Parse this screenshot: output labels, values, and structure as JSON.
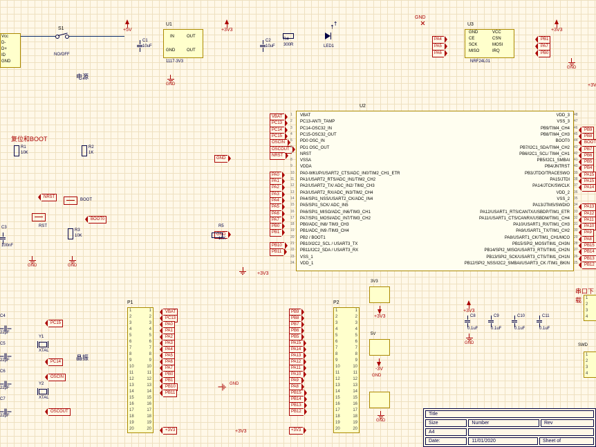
{
  "power_rails": {
    "p5v": "+5V",
    "p3v3": "+3V3",
    "gnd": "GND",
    "n3v": "-3V",
    "p5vlbl": "5V",
    "p3v3lbl": "3V3"
  },
  "sections": {
    "power": "电源",
    "reset_boot": "复位和BOOT",
    "crystal": "晶振",
    "serial": "串口下载"
  },
  "u1": {
    "ref": "U1",
    "value": "1117-3V3",
    "pins": [
      "IN",
      "OUT",
      "GND",
      "OUT"
    ]
  },
  "u2": {
    "ref": "U2",
    "left": [
      {
        "n": "1",
        "t": "VBAT",
        "net": "VBAT"
      },
      {
        "n": "2",
        "t": "PC13-ANTI_TAMP",
        "net": "PC13"
      },
      {
        "n": "3",
        "t": "PC14-OSC32_IN",
        "net": "PC14"
      },
      {
        "n": "4",
        "t": "PC15-OSC32_OUT",
        "net": "PC15"
      },
      {
        "n": "5",
        "t": "PD0 OSC_IN",
        "net": "OSCIN"
      },
      {
        "n": "6",
        "t": "PD1 OSC_OUT",
        "net": "OSCOUT"
      },
      {
        "n": "7",
        "t": "NRST",
        "net": "NRST"
      },
      {
        "n": "8",
        "t": "VSSA",
        "net": ""
      },
      {
        "n": "9",
        "t": "VDDA",
        "net": ""
      },
      {
        "n": "10",
        "t": "PA0-WKUP/USART2_CTS/ADC_IN0/TIM2_CH1_ETR",
        "net": "PA0"
      },
      {
        "n": "11",
        "t": "PA1/USART2_RTS/ADC_IN1/TIM2_CH2",
        "net": "PA1"
      },
      {
        "n": "12",
        "t": "PA2/USART2_TX/ ADC_IN2/ TIM2_CH3",
        "net": "PA2"
      },
      {
        "n": "13",
        "t": "PA3/USART2_RX/ADC_IN3/TIM2_CH4",
        "net": "PA3"
      },
      {
        "n": "14",
        "t": "PA4/SPI1_NSS/USART2_CK/ADC_IN4",
        "net": "PA4"
      },
      {
        "n": "15",
        "t": "PA5/SPI1_SCK/ ADC_IN5",
        "net": "PA5"
      },
      {
        "n": "16",
        "t": "PA6/SPI1_MISO/ADC_IN6/TIM3_CH1",
        "net": "PA6"
      },
      {
        "n": "17",
        "t": "PA7/SPI1_MOSI/ADC_IN7/TIM3_CH2",
        "net": "PA7"
      },
      {
        "n": "18",
        "t": "PB0/ADC_IN8/ TIM3_CH3",
        "net": "PB0"
      },
      {
        "n": "19",
        "t": "PB1/ADC_IN9 /TIM3_CH4",
        "net": "PB1"
      },
      {
        "n": "20",
        "t": "PB2 / BOOT1",
        "net": ""
      },
      {
        "n": "21",
        "t": "PB10/I2C2_SCL / USART3_TX",
        "net": "PB10"
      },
      {
        "n": "22",
        "t": "PB11/I2C2_SDA / USART3_RX",
        "net": "PB11"
      },
      {
        "n": "23",
        "t": "VSS_1",
        "net": ""
      },
      {
        "n": "24",
        "t": "VDD_1",
        "net": ""
      }
    ],
    "right": [
      {
        "n": "48",
        "t": "VDD_3",
        "net": ""
      },
      {
        "n": "47",
        "t": "VSS_3",
        "net": ""
      },
      {
        "n": "46",
        "t": "PB9/TIM4_CH4",
        "net": "PB9"
      },
      {
        "n": "45",
        "t": "PB8/TIM4_CH3",
        "net": "PB8"
      },
      {
        "n": "44",
        "t": "BOOT0",
        "net": "BOOT0"
      },
      {
        "n": "43",
        "t": "PB7/I2C1_SDA/TIM4_CH2",
        "net": "PB7"
      },
      {
        "n": "42",
        "t": "PB6/I2C1_SCL/ TIM4_CH1",
        "net": "PB6"
      },
      {
        "n": "41",
        "t": "PB5/I2C1_SMBAl",
        "net": "PB5"
      },
      {
        "n": "40",
        "t": "PB4/JNTRST",
        "net": "PB4"
      },
      {
        "n": "39",
        "t": "PB3/JTDO/TRACESWO",
        "net": "PA15"
      },
      {
        "n": "38",
        "t": "PA15/JTDI",
        "net": "PA15"
      },
      {
        "n": "37",
        "t": "PA14/JTCK/SWCLK",
        "net": "PA14"
      },
      {
        "n": "36",
        "t": "VDD_2",
        "net": ""
      },
      {
        "n": "35",
        "t": "VSS_2",
        "net": ""
      },
      {
        "n": "34",
        "t": "PA13/JTMS/SWDIO",
        "net": "PA13"
      },
      {
        "n": "33",
        "t": "PA12/USART1_RTS/CANTX/USBDP/TIM1_ETR",
        "net": "PA12"
      },
      {
        "n": "32",
        "t": "PA11/USART1_CTS/CANRX/USBDM/TIM1_CH4",
        "net": "PA11"
      },
      {
        "n": "31",
        "t": "PA10/USART1_RX/TIM1_CH3",
        "net": "PA10"
      },
      {
        "n": "30",
        "t": "PA9/USART1_TX/TIM1_CH2",
        "net": "PA9"
      },
      {
        "n": "29",
        "t": "PA8/USART1_CK/TIM1_CH1/MCO",
        "net": "PA8"
      },
      {
        "n": "28",
        "t": "PB15/SPI2_MOSI/TIM1_CH3N",
        "net": "PB15"
      },
      {
        "n": "27",
        "t": "PB14/SPI2_MISO/USART3_RTS/TIM1_CH2N",
        "net": "PB14"
      },
      {
        "n": "26",
        "t": "PB13/SPI2_SCK/USART3_CTS/TIM1_CH1N",
        "net": "PB13"
      },
      {
        "n": "25",
        "t": "PB12/SPI2_NSS/I2C2_SMBAl/USART3_CK /TIM1_BKIN",
        "net": "PB12"
      }
    ]
  },
  "nrf": {
    "ref": "U3",
    "value": "NRF24L01",
    "left": [
      "GND",
      "CE",
      "SCK",
      "MISO"
    ],
    "right": [
      "VCC",
      "CSN",
      "MOSI",
      "IRQ"
    ],
    "nets_left": [
      "",
      "PA4",
      "PA5",
      "PA6"
    ],
    "nets_right": [
      "PB1",
      "PA7",
      "PB0",
      ""
    ]
  },
  "usb": {
    "ref": "",
    "pins": [
      "Vcc",
      "D-",
      "D+",
      "ID",
      "GND"
    ]
  },
  "switch": {
    "ref": "S1",
    "value": "NO/OFF"
  },
  "parts": {
    "c1": {
      "ref": "C1",
      "val": "10uF"
    },
    "c2": {
      "ref": "C2",
      "val": "10uF"
    },
    "c3": {
      "ref": "C3",
      "val": "100nF"
    },
    "c4": {
      "ref": "C4",
      "val": "22pF"
    },
    "c5": {
      "ref": "C5",
      "val": "22pF"
    },
    "c6": {
      "ref": "C6",
      "val": "22pF"
    },
    "c7": {
      "ref": "C7",
      "val": "22pF"
    },
    "c8": {
      "ref": "C8",
      "val": "0.1uF"
    },
    "c9": {
      "ref": "C9",
      "val": "0.1uF"
    },
    "c10": {
      "ref": "C10",
      "val": "0.1uF"
    },
    "c11": {
      "ref": "C11",
      "val": "0.1uF"
    },
    "r1": {
      "ref": "R1",
      "val": "10K"
    },
    "r2": {
      "ref": "R2",
      "val": "1K"
    },
    "r3": {
      "ref": "R3",
      "val": "10K"
    },
    "r4": {
      "ref": "R4",
      "val": "300R"
    },
    "r5": {
      "ref": "R5",
      "val": "10K"
    },
    "led1": {
      "ref": "LED1"
    },
    "y1": {
      "ref": "Y1",
      "val": "XTAL"
    },
    "y2": {
      "ref": "Y2",
      "val": "XTAL"
    },
    "nrst": {
      "net": "NRST",
      "lbl": "RST"
    },
    "boot": {
      "net": "BOOT",
      "lbl": "BOOT0"
    }
  },
  "p1": {
    "ref": "P1",
    "nets": [
      "VBAT",
      "PC13",
      "PA0",
      "PA1",
      "PA2",
      "PA3",
      "PA4",
      "PA5",
      "PA6",
      "PA7",
      "PB0",
      "PB1",
      "PB10",
      "PB11",
      "",
      "",
      "",
      "",
      "",
      "+3V3"
    ]
  },
  "p2": {
    "ref": "P2",
    "nets": [
      "PB9",
      "PB8",
      "PB7",
      "PB6",
      "PB5",
      "PA15",
      "PA14",
      "PA13",
      "PA12",
      "PA11",
      "PA10",
      "PA9",
      "PA8",
      "PB15",
      "PB14",
      "PB13",
      "PB12",
      "",
      "",
      "+3V3"
    ]
  },
  "swd": {
    "ref": "SWD",
    "pins": [
      "1",
      "2",
      "3",
      "4"
    ]
  },
  "serial_conn": {
    "pins": [
      "1",
      "2",
      "3",
      "4"
    ]
  },
  "regs_3v3": {
    "lbl": "3V3"
  },
  "title_block": {
    "title": "Title",
    "size": "Size",
    "a4": "A4",
    "number": "Number",
    "rev": "Rev",
    "date": "Date:",
    "date_val": "11/01/2020",
    "sheet": "Sheet  of"
  }
}
